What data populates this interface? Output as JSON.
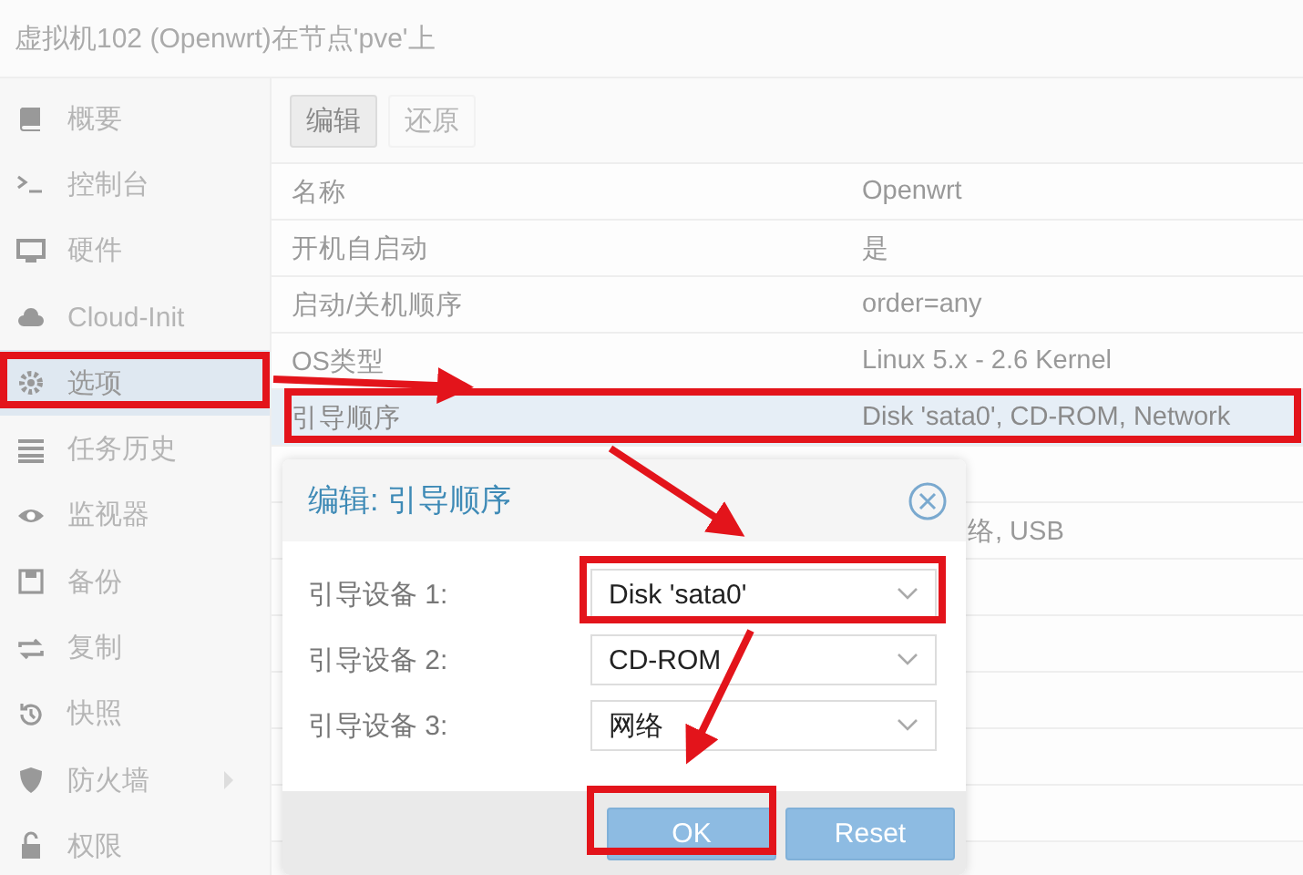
{
  "window": {
    "title": "虚拟机102 (Openwrt)在节点'pve'上"
  },
  "sidebar": {
    "items": [
      {
        "label": "概要",
        "selected": false
      },
      {
        "label": "控制台",
        "selected": false
      },
      {
        "label": "硬件",
        "selected": false
      },
      {
        "label": "Cloud-Init",
        "selected": false
      },
      {
        "label": "选项",
        "selected": true
      },
      {
        "label": "任务历史",
        "selected": false
      },
      {
        "label": "监视器",
        "selected": false
      },
      {
        "label": "备份",
        "selected": false
      },
      {
        "label": "复制",
        "selected": false
      },
      {
        "label": "快照",
        "selected": false
      },
      {
        "label": "防火墙",
        "selected": false,
        "expandable": true
      },
      {
        "label": "权限",
        "selected": false
      }
    ]
  },
  "toolbar": [
    {
      "label": "编辑",
      "disabled": false
    },
    {
      "label": "还原",
      "disabled": true
    }
  ],
  "table": {
    "rows": [
      {
        "label": "名称",
        "value": "Openwrt",
        "selected": false
      },
      {
        "label": "开机自启动",
        "value": "是",
        "selected": false
      },
      {
        "label": "启动/关机顺序",
        "value": "order=any",
        "selected": false
      },
      {
        "label": "OS类型",
        "value": "Linux 5.x - 2.6 Kernel",
        "selected": false
      },
      {
        "label": "引导顺序",
        "value": "Disk 'sata0', CD-ROM, Network",
        "selected": true
      },
      {
        "selected": false
      },
      {
        "value": "络, USB",
        "selected": false
      },
      {
        "selected": false
      },
      {
        "selected": false
      },
      {
        "selected": false
      },
      {
        "selected": false
      },
      {
        "selected": false
      }
    ]
  },
  "dialog": {
    "title": "编辑: 引导顺序",
    "fields": [
      {
        "label": "引导设备 1:",
        "value": "Disk 'sata0'"
      },
      {
        "label": "引导设备 2:",
        "value": "CD-ROM"
      },
      {
        "label": "引导设备 3:",
        "value": "网络"
      }
    ],
    "buttons": [
      "OK",
      "Reset"
    ]
  }
}
